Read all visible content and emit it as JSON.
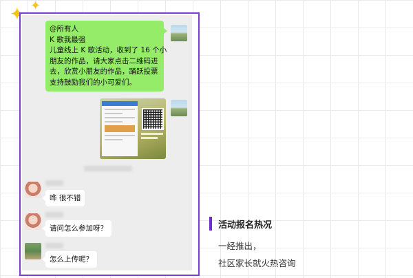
{
  "chat": {
    "group_message": {
      "lines": [
        "@所有人",
        "K 歌我最强",
        "儿童线上 K 歌活动，收到了 16 个小",
        "朋友的作品，请大家点击二维码进",
        "去，欣赏小朋友的作品，踊跃投票",
        "支持鼓励我们的小可爱们。"
      ]
    },
    "replies": [
      {
        "text": "哗 很不错"
      },
      {
        "text": "请问怎么参加呀？"
      },
      {
        "text": "怎么上传呢？"
      }
    ]
  },
  "side": {
    "title": "活动报名热况",
    "line1": "一经推出，",
    "line2": "社区家长就火热咨询"
  },
  "colors": {
    "frame": "#7a3fd0",
    "accent_bar": "#6b2fcf",
    "sent_bubble": "#95ec69",
    "chat_bg": "#ededed",
    "sparkle": "#f5c518"
  },
  "icons": [
    "sparkle-icon",
    "avatar",
    "qr-code",
    "poster-image"
  ]
}
